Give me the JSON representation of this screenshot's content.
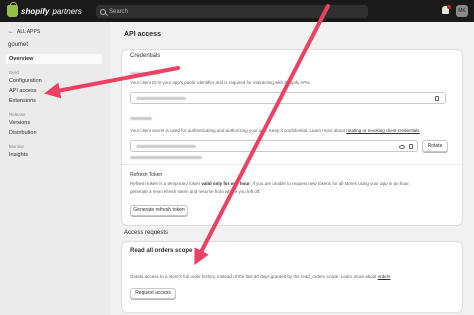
{
  "topbar": {
    "brand_name": "shopify",
    "brand_sub": "partners",
    "search_placeholder": "Search",
    "avatar_initials": "MK"
  },
  "sidebar": {
    "back_label": "ALL APPS",
    "app_name": "goumet",
    "overview": "Overview",
    "build_section": "Build",
    "configuration": "Configuration",
    "api_access": "API access",
    "extensions": "Extensions",
    "release_section": "Release",
    "versions": "Versions",
    "distribution": "Distribution",
    "monitor_section": "Monitor",
    "insights": "Insights"
  },
  "main": {
    "page_title": "API access",
    "credentials_title": "Credentials",
    "client_id_help": "Your client ID is your app's public identifier and is required for interacting with Shopify APIs.",
    "client_secret_help": "Your client secret is used for authenticating and authorizing your app. Keep it confidential. Learn more about",
    "client_secret_link": "rotating or revoking client credentials",
    "rotate_button": "Rotate",
    "refresh_title": "Refresh Token",
    "refresh_help_1": "Refresh token is a temporary token",
    "refresh_help_bold": "valid only for one hour",
    "refresh_help_2": ". If you are unable to request new tokens for all stores using your app in an hour,",
    "refresh_help_3": "generate a new refresh token and resume from where you left off.",
    "refresh_button": "Generate refresh token",
    "access_requests_title": "Access requests",
    "orders_title": "Read all orders scope",
    "orders_help": "Grants access to a store's full order history, instead of the last 60 days granted by the read_orders scope. Learn more about",
    "orders_link": "orders",
    "request_button": "Request access"
  },
  "colors": {
    "arrow": "#ee4062",
    "topbar": "#1a1a1a",
    "brand_green": "#95bf47"
  }
}
